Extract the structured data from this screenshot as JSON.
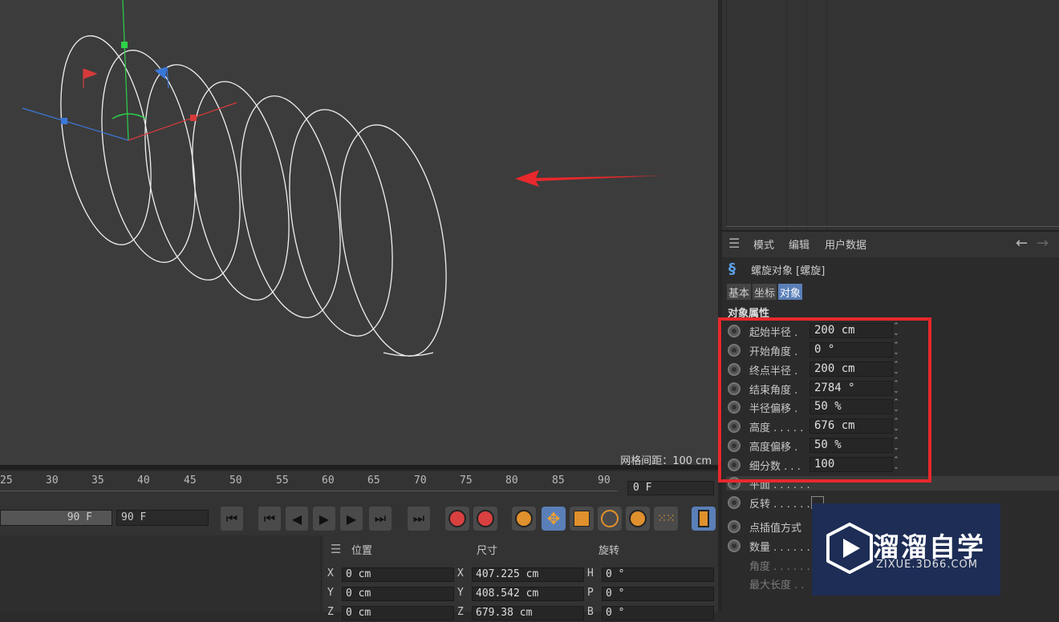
{
  "viewport": {
    "grid_spacing": "网格间距：100 cm"
  },
  "timeline": {
    "ruler_ticks": [
      "25",
      "30",
      "35",
      "40",
      "45",
      "50",
      "55",
      "60",
      "65",
      "70",
      "75",
      "80",
      "85",
      "90"
    ],
    "current_frame": "0 F",
    "end_frame_left": "90 F",
    "end_frame_right": "90 F"
  },
  "coordinates": {
    "headers": {
      "position": "位置",
      "size": "尺寸",
      "rotation": "旋转"
    },
    "rows": [
      {
        "pos_axis": "X",
        "pos_value": "0 cm",
        "size_axis": "X",
        "size_value": "407.225 cm",
        "rot_axis": "H",
        "rot_value": "0 °"
      },
      {
        "pos_axis": "Y",
        "pos_value": "0 cm",
        "size_axis": "Y",
        "size_value": "408.542 cm",
        "rot_axis": "P",
        "rot_value": "0 °"
      },
      {
        "pos_axis": "Z",
        "pos_value": "0 cm",
        "size_axis": "Z",
        "size_value": "679.38 cm",
        "rot_axis": "B",
        "rot_value": "0 °"
      }
    ]
  },
  "attributes": {
    "menu": [
      "模式",
      "编辑",
      "用户数据"
    ],
    "object_title": "螺旋对象 [螺旋]",
    "tabs": [
      "基本",
      "坐标",
      "对象"
    ],
    "active_tab": "对象",
    "section": "对象属性",
    "properties": [
      {
        "label": "起始半径 .",
        "value": "200 cm"
      },
      {
        "label": "开始角度 .",
        "value": "0 °"
      },
      {
        "label": "终点半径 .",
        "value": "200 cm"
      },
      {
        "label": "结束角度 .",
        "value": "2784 °"
      },
      {
        "label": "半径偏移 .",
        "value": "50 %"
      },
      {
        "label": "高度 . . . . .",
        "value": "676 cm"
      },
      {
        "label": "高度偏移 .",
        "value": "50 %"
      },
      {
        "label": "细分数 . . .",
        "value": "100"
      }
    ],
    "extra_properties": [
      {
        "label": "平面 . . . . . ."
      },
      {
        "label": "反转 . . . . . ."
      },
      {
        "label": "点插值方式"
      },
      {
        "label": "数量 . . . . . ."
      },
      {
        "label": "角度 . . . . . ."
      },
      {
        "label": "最大长度 . ."
      }
    ]
  },
  "watermark": {
    "brand": "溜溜自学",
    "url": "ZIXUE.3D66.COM"
  },
  "colors": {
    "highlight": "#e8282c",
    "accent": "#5a7fb8",
    "arrow": "#e8282c"
  }
}
